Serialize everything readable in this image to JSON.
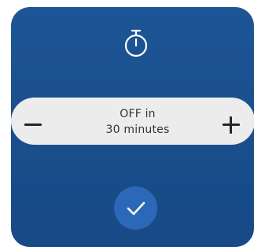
{
  "sleep_timer": {
    "icon": "stopwatch-icon",
    "status_line1": "OFF in",
    "status_line2": "30 minutes",
    "decrease_icon": "minus-icon",
    "increase_icon": "plus-icon",
    "confirm_icon": "checkmark-icon"
  },
  "colors": {
    "panel": "#1a4f8d",
    "pill": "#ececec",
    "confirm_button": "#2b69b8",
    "text": "#333333",
    "icon_light": "#ffffff"
  }
}
